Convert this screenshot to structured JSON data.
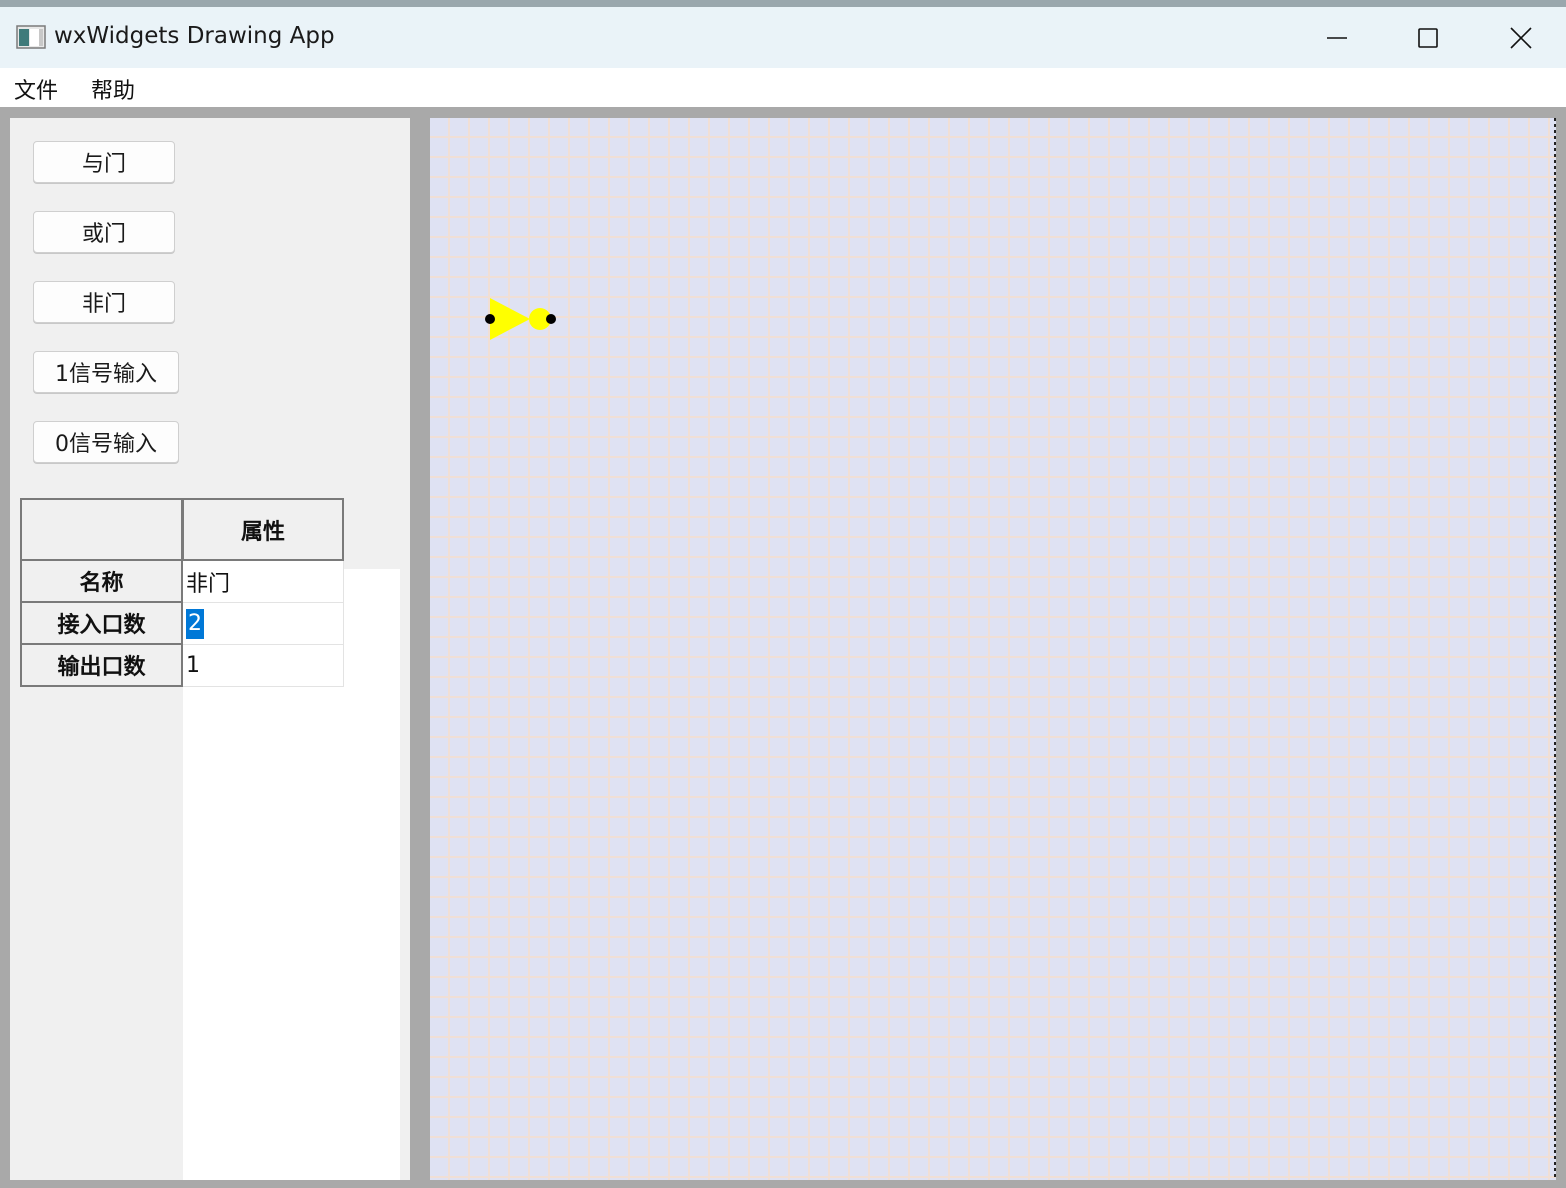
{
  "window": {
    "title": "wxWidgets Drawing App"
  },
  "menu": {
    "items": [
      "文件",
      "帮助"
    ]
  },
  "toolbox": {
    "buttons": [
      "与门",
      "或门",
      "非门",
      "1信号输入",
      "0信号输入"
    ]
  },
  "properties": {
    "header": "属性",
    "rows": [
      {
        "label": "名称",
        "value": "非门"
      },
      {
        "label": "接入口数",
        "value": "2"
      },
      {
        "label": "输出口数",
        "value": "1"
      }
    ]
  },
  "canvas": {
    "component": "非门",
    "gate_color": "#ffff00",
    "pin_color": "#000000",
    "background_color": "#dfe2f3",
    "grid_line_color": "#f0dfd6"
  }
}
